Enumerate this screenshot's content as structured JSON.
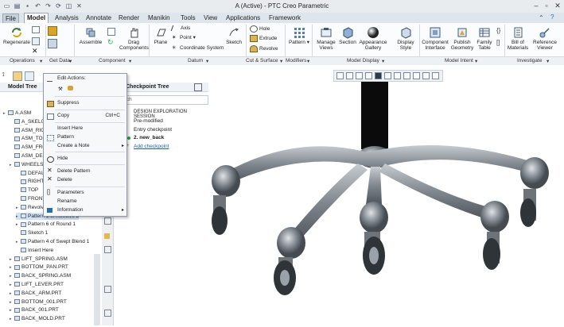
{
  "window": {
    "title": "A (Active) - PTC Creo Parametric",
    "quick_access_icons": [
      "new-icon",
      "open-icon",
      "save-icon",
      "undo-icon",
      "redo-icon",
      "regenerate-icon",
      "window-icon",
      "close-window-icon"
    ]
  },
  "menu_tabs": [
    "File",
    "Model",
    "Analysis",
    "Annotate",
    "Render",
    "Manikin",
    "Tools",
    "View",
    "Applications",
    "Framework"
  ],
  "active_tab": "Model",
  "ribbon": {
    "operations": {
      "regenerate": "Regenerate",
      "group": "Operations"
    },
    "get_data": {
      "group": "Get Data"
    },
    "component": {
      "assemble": "Assemble",
      "drag": "Drag Components",
      "group": "Component"
    },
    "datum": {
      "plane": "Plane",
      "axis": "Axis",
      "point": "Point",
      "csys": "Coordinate System",
      "sketch": "Sketch",
      "group": "Datum"
    },
    "cut_surface": {
      "hole": "Hole",
      "extrude": "Extrude",
      "revolve": "Revolve",
      "group": "Cut & Surface"
    },
    "modifiers": {
      "pattern": "Pattern",
      "group": "Modifiers"
    },
    "model_display": {
      "manage_views": "Manage Views",
      "section": "Section",
      "appearance": "Appearance Gallery",
      "display_style": "Display Style",
      "group": "Model Display"
    },
    "model_intent": {
      "component_interface": "Component Interface",
      "publish_geometry": "Publish Geometry",
      "family_table": "Family Table",
      "group": "Model Intent"
    },
    "investigate": {
      "bom": "Bill of Materials",
      "reference_viewer": "Reference Viewer",
      "group": "Investigate"
    }
  },
  "model_tree": {
    "title": "Model Tree",
    "items": [
      {
        "label": "A.ASM",
        "indent": 0
      },
      {
        "label": "A_SKEL001",
        "indent": 1
      },
      {
        "label": "ASM_RIGHT",
        "indent": 1
      },
      {
        "label": "ASM_TOP",
        "indent": 1
      },
      {
        "label": "ASM_FRONT",
        "indent": 1
      },
      {
        "label": "ASM_DEF_",
        "indent": 1
      },
      {
        "label": "WHEELS_",
        "indent": 1
      },
      {
        "label": "DEFAUL",
        "indent": 2
      },
      {
        "label": "RIGHT",
        "indent": 2
      },
      {
        "label": "TOP",
        "indent": 2
      },
      {
        "label": "FRONT",
        "indent": 2
      },
      {
        "label": "Revolve",
        "indent": 2
      },
      {
        "label": "Pattern 1 of Revolve 2",
        "indent": 2
      },
      {
        "label": "Pattern 6 of Round 1",
        "indent": 2
      },
      {
        "label": "Sketch 1",
        "indent": 2
      },
      {
        "label": "Pattern 4 of Swept Blend 1",
        "indent": 2
      },
      {
        "label": "Insert Here",
        "indent": 2
      },
      {
        "label": "LIFT_SPRING.ASM",
        "indent": 1
      },
      {
        "label": "BOTTOM_PAN.PRT",
        "indent": 1
      },
      {
        "label": "BACK_SPRING.ASM",
        "indent": 1
      },
      {
        "label": "LIFT_LEVER.PRT",
        "indent": 1
      },
      {
        "label": "BACK_ARM.PRT",
        "indent": 1
      },
      {
        "label": "BOTTOM_001.PRT",
        "indent": 1
      },
      {
        "label": "BACK_001.PRT",
        "indent": 1
      },
      {
        "label": "BACK_MOLD.PRT",
        "indent": 1
      }
    ]
  },
  "checkpoint_tree": {
    "title": "Checkpoint Tree",
    "search_placeholder": "Search",
    "session_label": "DESIGN EXPLORATION SESSION",
    "items": [
      "Pre-modified",
      "Entry checkpoint",
      "2. new_back",
      "Add checkpoint"
    ]
  },
  "context_menu": {
    "header": "Edit Actions:",
    "items": [
      {
        "label": "Suppress",
        "shortcut": ""
      },
      {
        "label": "Copy",
        "shortcut": "Ctrl+C"
      },
      {
        "label": "Insert Here",
        "shortcut": ""
      },
      {
        "label": "Pattern",
        "shortcut": ""
      },
      {
        "label": "Create a Note",
        "shortcut": ""
      },
      {
        "label": "Hide",
        "shortcut": ""
      },
      {
        "label": "Delete Pattern",
        "shortcut": ""
      },
      {
        "label": "Delete",
        "shortcut": ""
      },
      {
        "label": "Parameters",
        "shortcut": ""
      },
      {
        "label": "Rename",
        "shortcut": ""
      },
      {
        "label": "Information",
        "shortcut": ""
      }
    ]
  },
  "colors": {
    "accent": "#2b6cb0",
    "ribbon_bg": "#fbfcfd",
    "tabs_bg": "#dfe5ec",
    "model_gray": "#7d838a"
  }
}
